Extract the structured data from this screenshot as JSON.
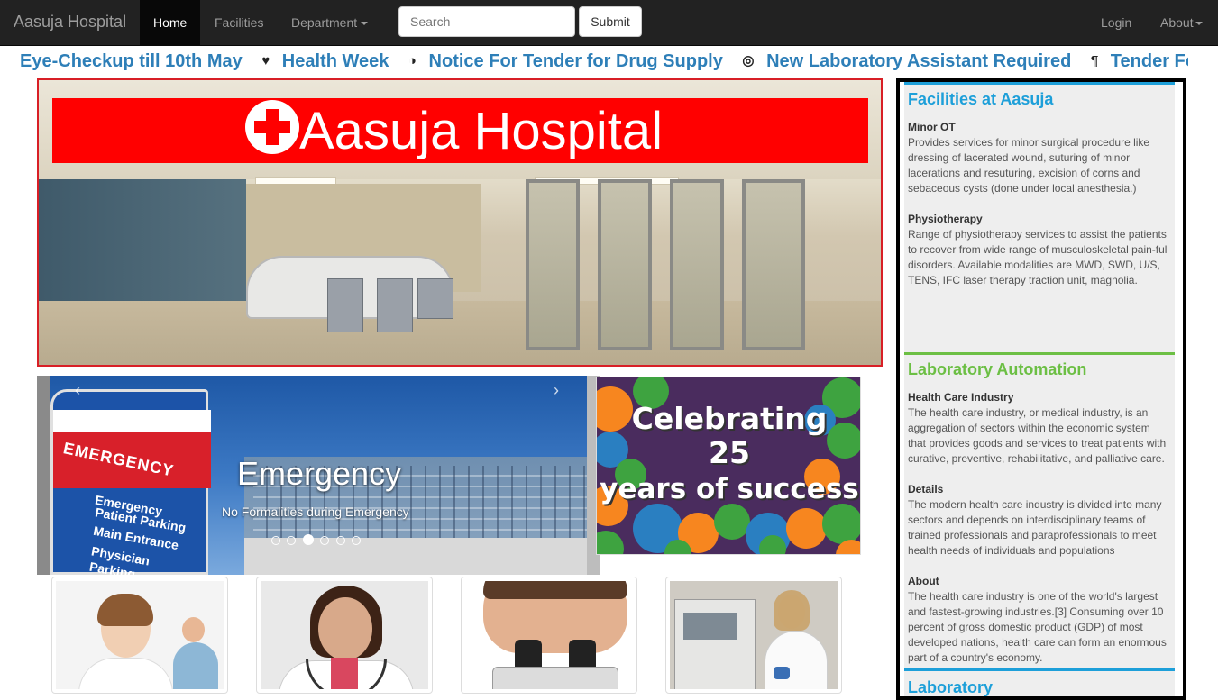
{
  "navbar": {
    "brand": "Aasuja Hospital",
    "home": "Home",
    "facilities": "Facilities",
    "department": "Department",
    "search_placeholder": "Search",
    "submit": "Submit",
    "login": "Login",
    "about": "About"
  },
  "ticker": {
    "items": [
      {
        "icon": "",
        "text": "Eye-Checkup till 10th May"
      },
      {
        "icon": "heart-icon",
        "text": "Health Week"
      },
      {
        "icon": "tint-icon",
        "text": "Notice For Tender for Drug Supply"
      },
      {
        "icon": "record-icon",
        "text": "New Laboratory Assistant Required"
      },
      {
        "icon": "cutlery-icon",
        "text": "Tender For C"
      }
    ]
  },
  "hero": {
    "title": "Aasuja Hospital"
  },
  "carousel": {
    "title": "Emergency",
    "text": "No Formalities during Emergency",
    "sign_title": "EMERGENCY",
    "sign_lines": [
      "Emergency",
      "Patient Parking",
      "Main Entrance",
      "Physician",
      "Parking"
    ],
    "prev": "‹",
    "next": "›"
  },
  "celebrate": {
    "line1": "Celebrating",
    "line2": "25",
    "line3": "years of success"
  },
  "sidebar": {
    "facilities": {
      "title": "Facilities at Aasuja",
      "items": [
        {
          "name": "Minor OT",
          "text": "Provides services for minor surgical procedure like dressing of lacerated wound, suturing of minor lacerations and resuturing, excision of corns and sebaceous cysts (done under local anesthesia.)"
        },
        {
          "name": "Physiotherapy",
          "text": "Range of physiotherapy services to assist the patients to recover from wide range of musculoskeletal pain-ful disorders. Available modalities are MWD, SWD, U/S, TENS, IFC laser therapy traction unit, magnolia."
        }
      ]
    },
    "lab": {
      "title": "Laboratory Automation",
      "items": [
        {
          "name": "Health Care Industry",
          "text": "The health care industry, or medical industry, is an aggregation of sectors within the economic system that provides goods and services to treat patients with curative, preventive, rehabilitative, and palliative care."
        },
        {
          "name": "Details",
          "text": "The modern health care industry is divided into many sectors and depends on interdisciplinary teams of trained professionals and paraprofessionals to meet health needs of individuals and populations"
        },
        {
          "name": "About",
          "text": "The health care industry is one of the world's largest and fastest-growing industries.[3] Consuming over 10 percent of gross domestic product (GDP) of most developed nations, health care can form an enormous part of a country's economy."
        }
      ]
    },
    "next_title": "Laboratory"
  },
  "colors": {
    "brand_red": "#ff0000",
    "ticker_blue": "#2e7fb8",
    "side_blue": "#1d9fd9",
    "side_green": "#6cbf44"
  }
}
